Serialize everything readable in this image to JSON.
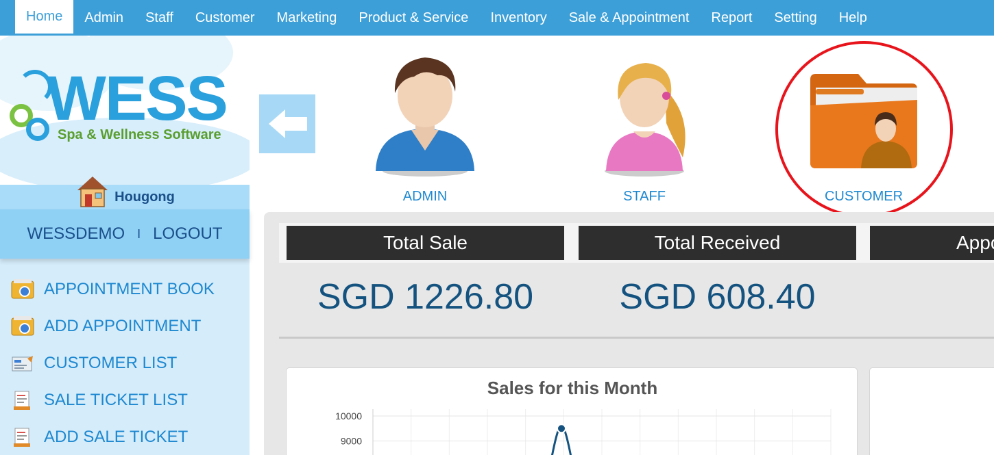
{
  "nav": {
    "items": [
      {
        "label": "Home",
        "active": true
      },
      {
        "label": "Admin"
      },
      {
        "label": "Staff"
      },
      {
        "label": "Customer"
      },
      {
        "label": "Marketing"
      },
      {
        "label": "Product & Service"
      },
      {
        "label": "Inventory"
      },
      {
        "label": "Sale & Appointment"
      },
      {
        "label": "Report"
      },
      {
        "label": "Setting"
      },
      {
        "label": "Help"
      }
    ]
  },
  "logo": {
    "word": "WESS",
    "tagline": "Spa & Wellness Software"
  },
  "branch": {
    "name": "Hougong"
  },
  "user": {
    "username": "WESSDEMO",
    "separator": "I",
    "logout": "LOGOUT"
  },
  "menu": {
    "items": [
      {
        "label": "APPOINTMENT BOOK",
        "icon": "appointment-book-icon"
      },
      {
        "label": "ADD APPOINTMENT",
        "icon": "add-appointment-icon"
      },
      {
        "label": "CUSTOMER LIST",
        "icon": "customer-list-icon"
      },
      {
        "label": "SALE TICKET LIST",
        "icon": "sale-ticket-icon"
      },
      {
        "label": "ADD SALE TICKET",
        "icon": "add-sale-ticket-icon"
      }
    ]
  },
  "shortcuts": [
    {
      "label": "ADMIN",
      "icon": "admin-avatar-icon"
    },
    {
      "label": "STAFF",
      "icon": "staff-avatar-icon"
    },
    {
      "label": "CUSTOMER",
      "icon": "customer-folder-icon"
    }
  ],
  "stats": [
    {
      "title": "Total Sale",
      "value": "SGD 1226.80"
    },
    {
      "title": "Total Received",
      "value": "SGD 608.40"
    },
    {
      "title": "Appo",
      "value": ""
    }
  ],
  "chart_data": {
    "type": "line",
    "title": "Sales for this Month",
    "y_ticks": [
      "10000",
      "9000"
    ],
    "visible_point": {
      "y": 9500
    }
  },
  "colors": {
    "nav": "#3d9fd8",
    "highlight": "#e8141c",
    "stat_value": "#14527f"
  }
}
